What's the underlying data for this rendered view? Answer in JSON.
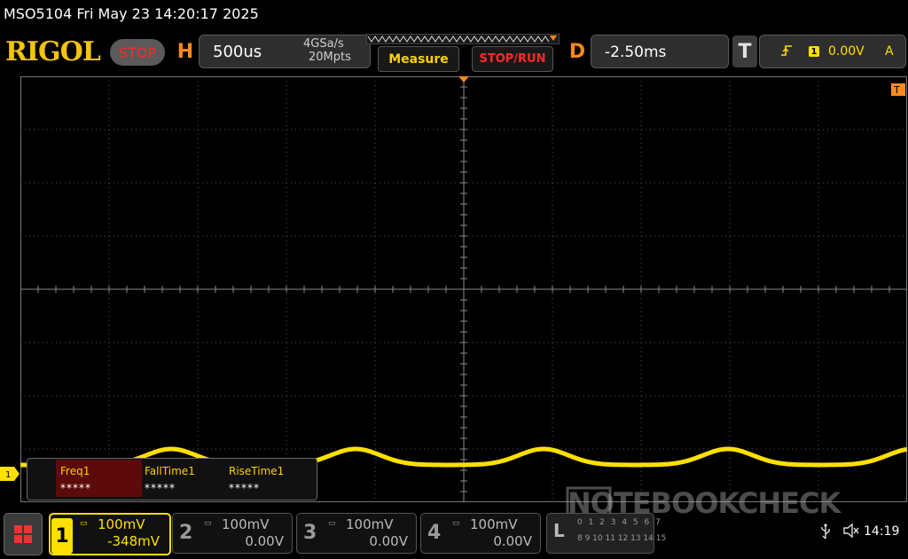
{
  "header": {
    "model": "MSO5104",
    "datetime": "Fri May 23 14:20:17 2025",
    "title": "MSO5104  Fri May 23 14:20:17 2025",
    "logo": "RIGOL",
    "run_state": "STOP"
  },
  "horizontal": {
    "label": "H",
    "timebase": "500us",
    "sample_rate": "4GSa/s",
    "memory_depth": "20Mpts"
  },
  "buttons": {
    "measure": "Measure",
    "stop_run": "STOP/RUN"
  },
  "delay": {
    "label": "D",
    "value": "-2.50ms"
  },
  "trigger": {
    "label": "T",
    "edge_icon": "rising-edge-icon",
    "source": "1",
    "level": "0.00V",
    "mode": "A"
  },
  "display": {
    "ch1_marker": "1",
    "trigger_position_marker": "T"
  },
  "measurements": [
    {
      "name": "Freq1",
      "value": "*****"
    },
    {
      "name": "FallTime1",
      "value": "*****"
    },
    {
      "name": "RiseTime1",
      "value": "*****"
    }
  ],
  "channels": [
    {
      "num": "1",
      "scale": "100mV",
      "offset": "-348mV",
      "active": true,
      "color": "#ffe000"
    },
    {
      "num": "2",
      "scale": "100mV",
      "offset": "0.00V",
      "active": false,
      "color": "#bbbbbb"
    },
    {
      "num": "3",
      "scale": "100mV",
      "offset": "0.00V",
      "active": false,
      "color": "#bbbbbb"
    },
    {
      "num": "4",
      "scale": "100mV",
      "offset": "0.00V",
      "active": false,
      "color": "#bbbbbb"
    }
  ],
  "logic_analyzer": {
    "label": "L",
    "row1": "0 1 2 3 4 5 6 7",
    "row2": "8 9 10 11 12 13 14 15"
  },
  "watermark": "NOTEBOOKCHECK",
  "status": {
    "usb_icon": "usb-icon",
    "speaker_icon": "speaker-muted-icon",
    "time": "14:19"
  },
  "colors": {
    "ch1": "#ffe000",
    "accent_orange": "#ff8a1c",
    "stop_red": "#ff2a2a"
  }
}
